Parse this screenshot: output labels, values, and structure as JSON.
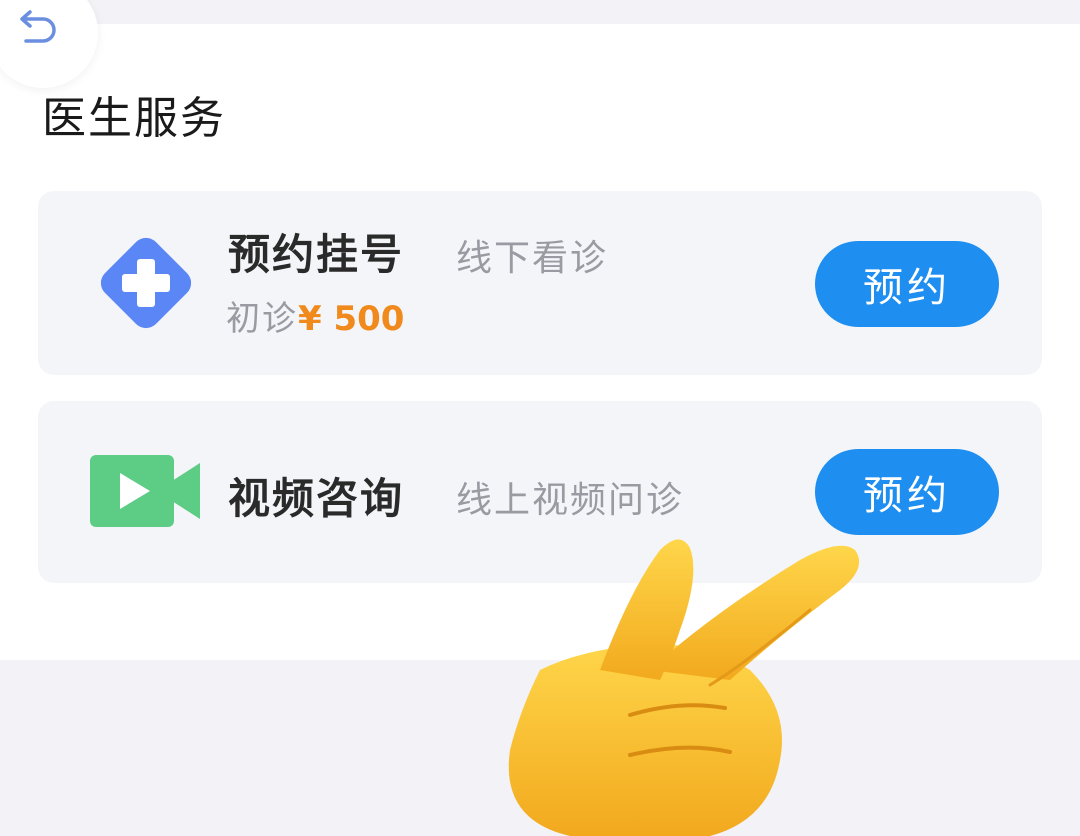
{
  "header": {
    "back_icon": "back-arrow-icon",
    "section_title": "医生服务"
  },
  "services": [
    {
      "icon": "medical-cross-icon",
      "icon_color": "#5b86f5",
      "title": "预约挂号",
      "subtitle": "线下看诊",
      "price_label": "初诊",
      "price_value": "¥ 500",
      "button_label": "预约"
    },
    {
      "icon": "video-camera-icon",
      "icon_color": "#5dcc84",
      "title": "视频咨询",
      "subtitle": "线上视频问诊",
      "button_label": "预约"
    }
  ],
  "overlay": {
    "pointing_hand_icon": "pointing-hand-emoji"
  },
  "colors": {
    "accent_button": "#1e8ef0",
    "price": "#f08a1c",
    "card_background": "#f4f5f8"
  }
}
